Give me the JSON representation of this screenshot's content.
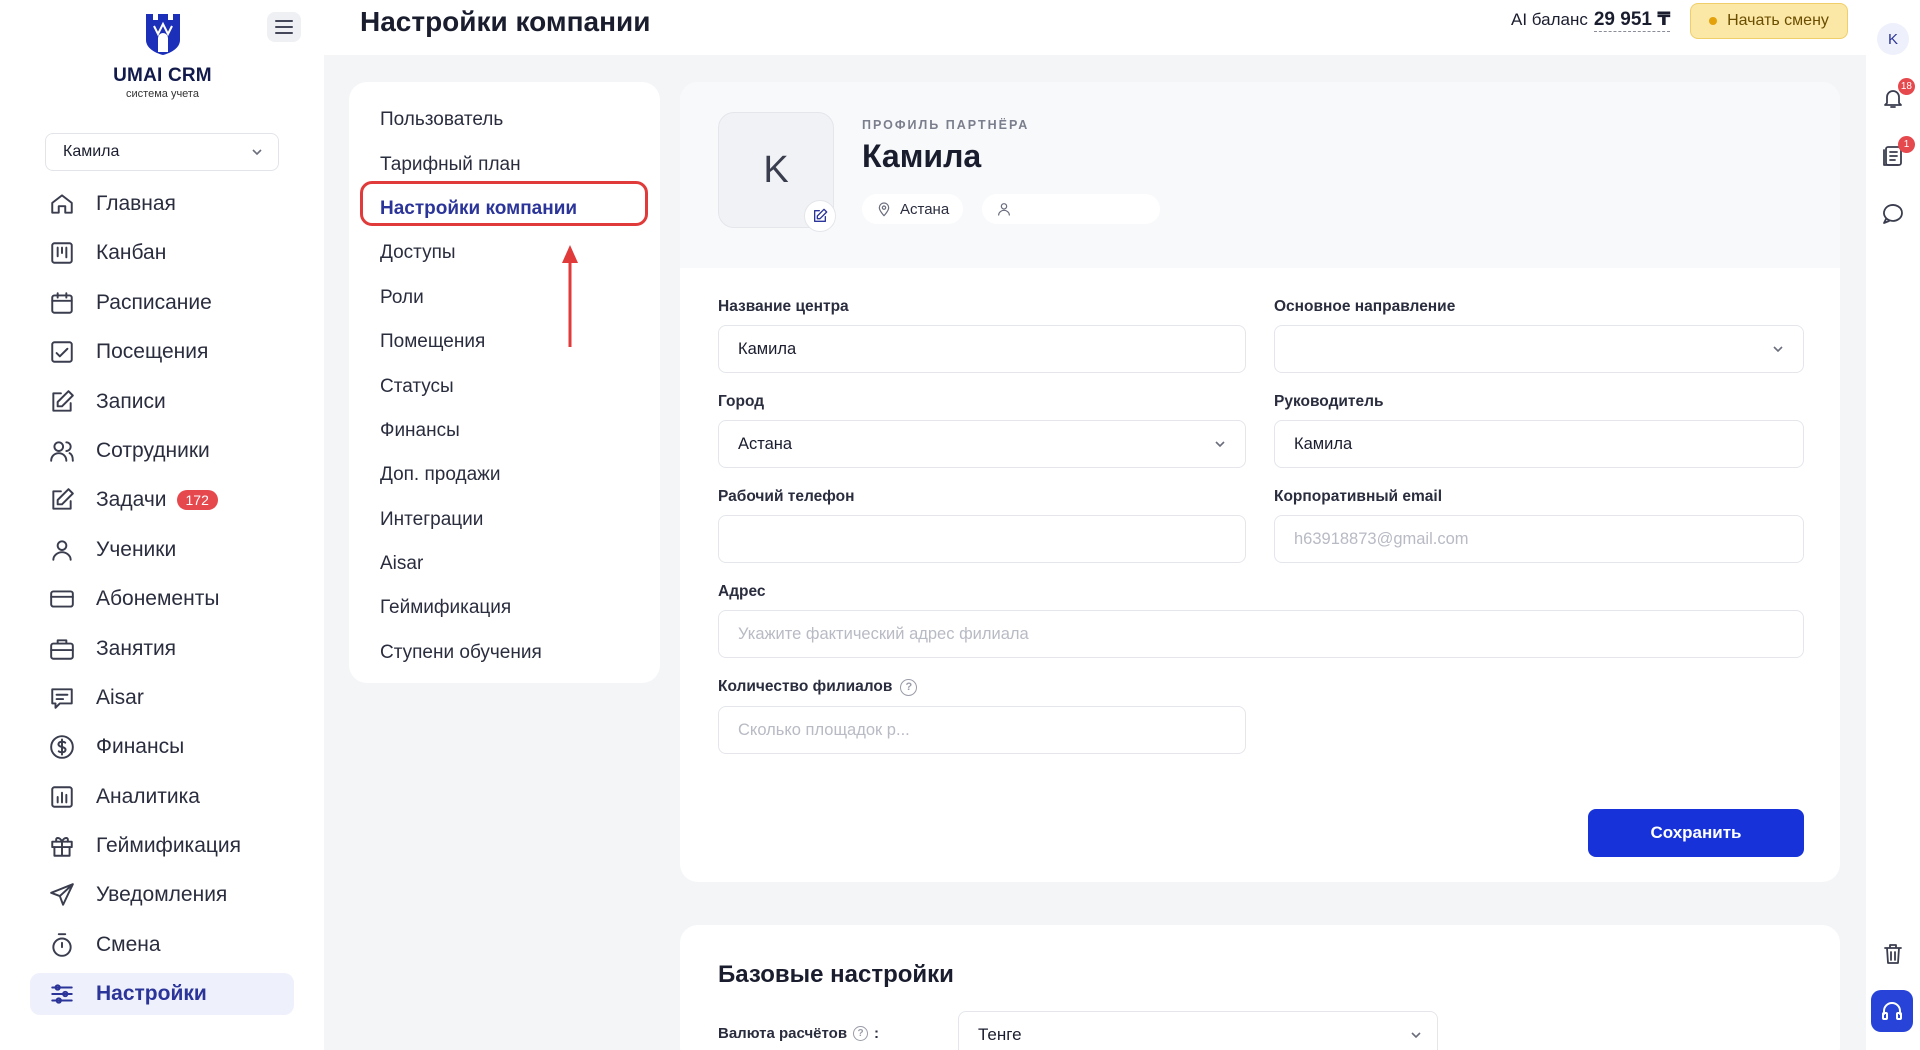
{
  "app": {
    "logo_title": "UMAI CRM",
    "logo_subtitle": "система учета",
    "page_title": "Настройки компании"
  },
  "topbar": {
    "ai_balance_label": "AI баланс",
    "ai_balance_value": "29 951 ₸",
    "start_shift_label": "Начать смену"
  },
  "sidebar": {
    "branch_value": "Камила",
    "items": [
      {
        "label": "Главная",
        "icon": "home-icon"
      },
      {
        "label": "Канбан",
        "icon": "kanban-icon"
      },
      {
        "label": "Расписание",
        "icon": "calendar-icon"
      },
      {
        "label": "Посещения",
        "icon": "attendance-icon"
      },
      {
        "label": "Записи",
        "icon": "edit-icon"
      },
      {
        "label": "Сотрудники",
        "icon": "users-icon"
      },
      {
        "label": "Задачи",
        "icon": "tasks-icon",
        "badge": "172"
      },
      {
        "label": "Ученики",
        "icon": "user-icon"
      },
      {
        "label": "Абонементы",
        "icon": "card-icon"
      },
      {
        "label": "Занятия",
        "icon": "briefcase-icon"
      },
      {
        "label": "Aisar",
        "icon": "chat-icon"
      },
      {
        "label": "Финансы",
        "icon": "dollar-icon"
      },
      {
        "label": "Аналитика",
        "icon": "chart-icon"
      },
      {
        "label": "Геймификация",
        "icon": "gift-icon"
      },
      {
        "label": "Уведомления",
        "icon": "send-icon"
      },
      {
        "label": "Смена",
        "icon": "timer-icon"
      },
      {
        "label": "Настройки",
        "icon": "sliders-icon",
        "active": true
      }
    ]
  },
  "rail": {
    "avatar_letter": "K",
    "notifications_badge": "18",
    "documents_badge": "1"
  },
  "settings_menu": {
    "items": [
      "Пользователь",
      "Тарифный план",
      "Настройки компании",
      "Доступы",
      "Роли",
      "Помещения",
      "Статусы",
      "Финансы",
      "Доп. продажи",
      "Интеграции",
      "Aisar",
      "Геймификация",
      "Ступени обучения"
    ],
    "active_index": 2
  },
  "profile": {
    "avatar_letter": "K",
    "caption": "ПРОФИЛЬ ПАРТНЁРА",
    "name": "Камила",
    "city_chip": "Астана",
    "person_chip": ""
  },
  "form": {
    "center_name_label": "Название центра",
    "center_name_value": "Камила",
    "direction_label": "Основное направление",
    "direction_value": "",
    "city_label": "Город",
    "city_value": "Астана",
    "manager_label": "Руководитель",
    "manager_value": "Камила",
    "phone_label": "Рабочий телефон",
    "phone_value": "",
    "email_label": "Корпоративный email",
    "email_placeholder": "h63918873@gmail.com",
    "address_label": "Адрес",
    "address_placeholder": "Укажите фактический адрес филиала",
    "branches_label": "Количество филиалов",
    "branches_placeholder": "Сколько площадок р...",
    "save_label": "Сохранить"
  },
  "basic_settings": {
    "title": "Базовые настройки",
    "currency_label": "Валюта расчётов",
    "currency_suffix": ":",
    "currency_value": "Тенге"
  },
  "colors": {
    "accent": "#2b3499",
    "primary_button": "#1632d8",
    "highlight": "#e03a3a",
    "shift_button": "#fbe7a6",
    "badge": "#e5484d"
  }
}
